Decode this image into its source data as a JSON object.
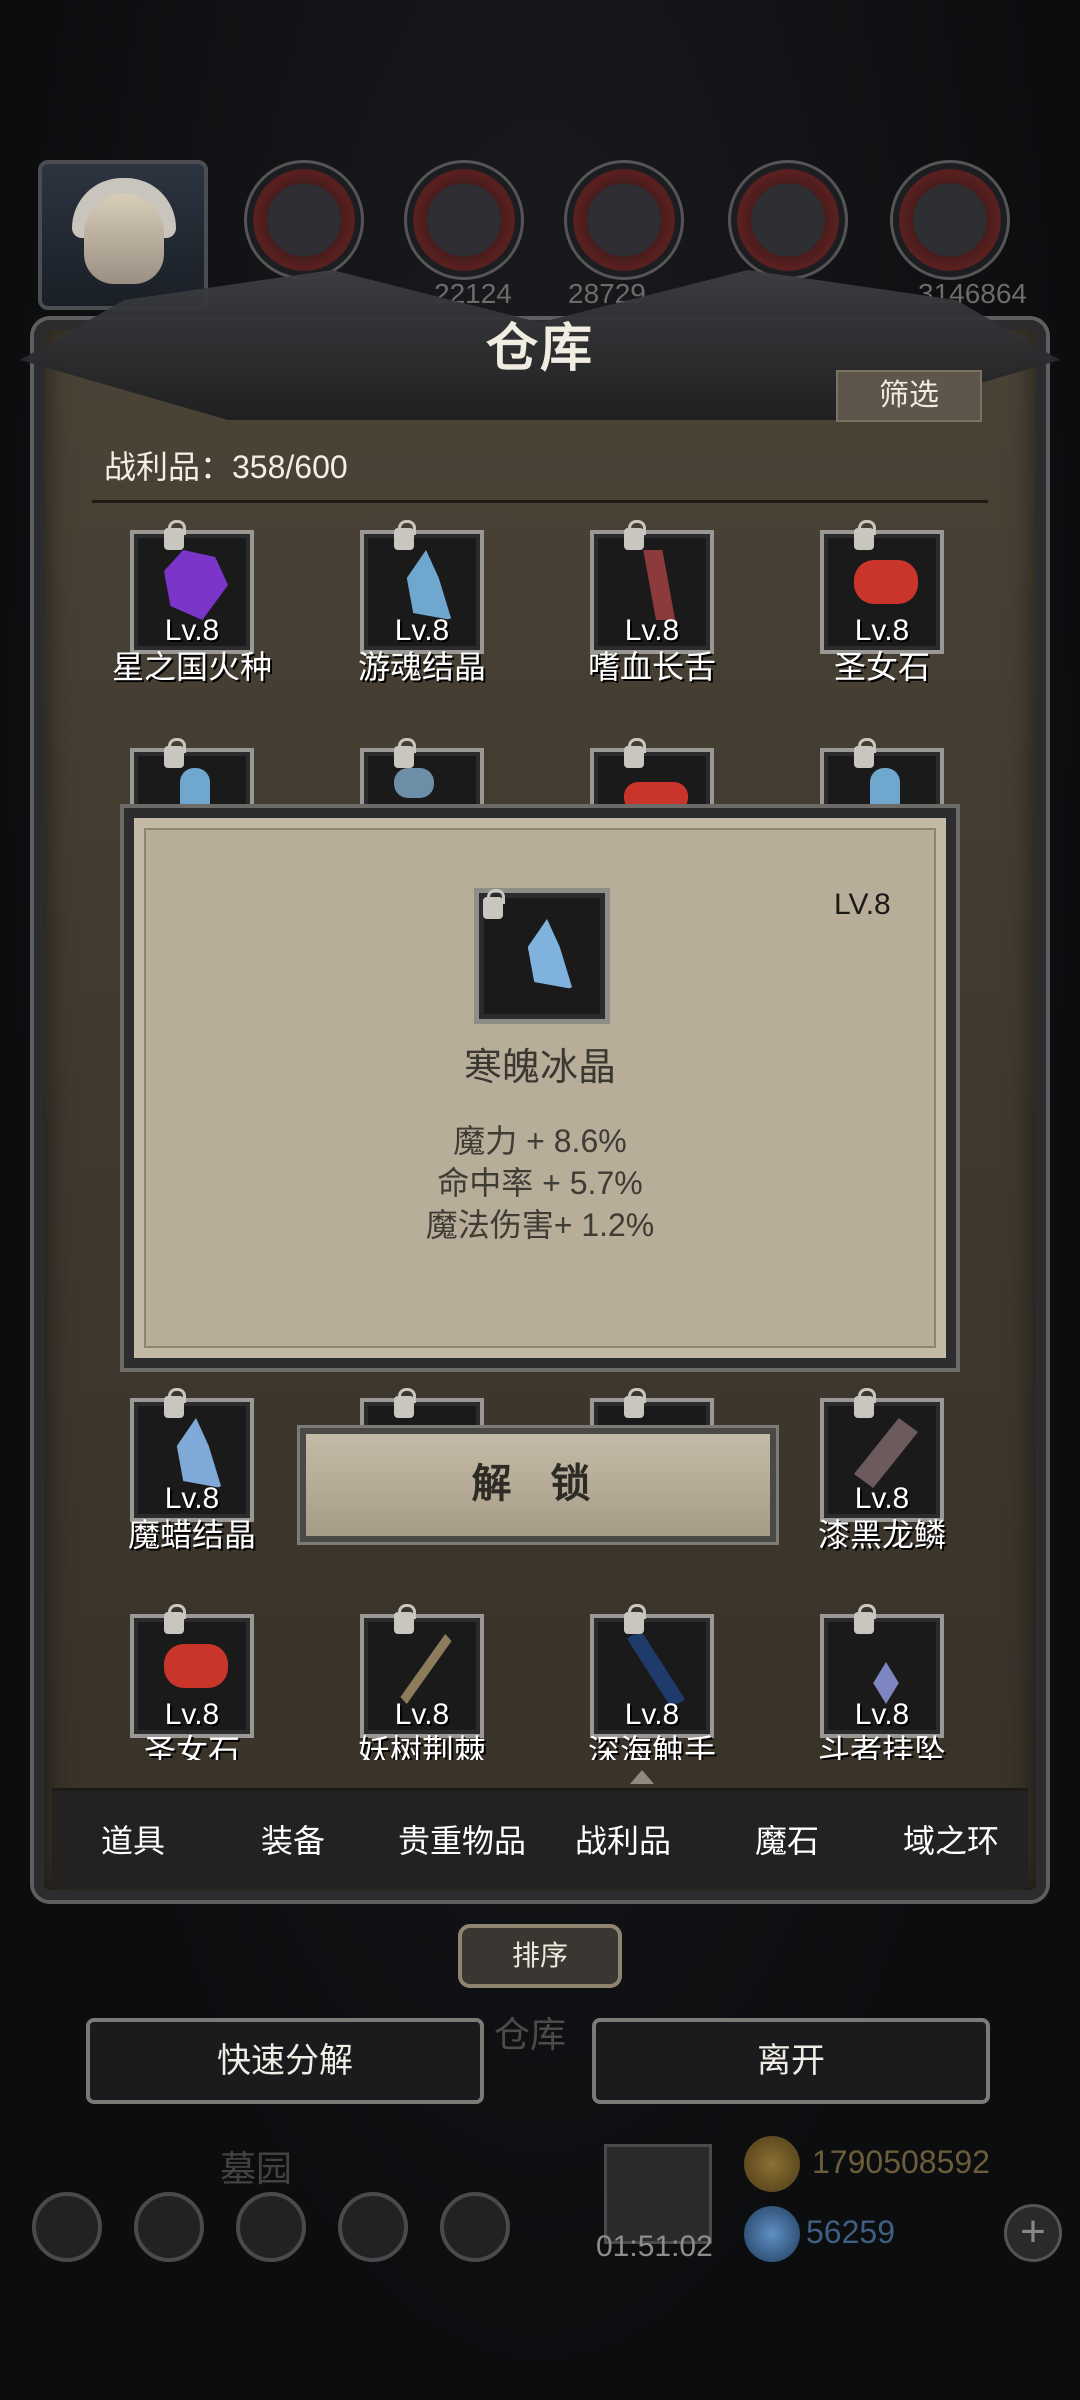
{
  "top": {
    "resources": [
      "",
      "",
      "22124",
      "28729",
      "",
      "3146864"
    ]
  },
  "warehouse": {
    "title": "仓库",
    "filter_label": "筛选",
    "loot_count": "战利品：358/600",
    "items_row1": [
      {
        "name": "星之国火种",
        "level": "Lv.8",
        "gem_color": "#7b35c9"
      },
      {
        "name": "游魂结晶",
        "level": "Lv.8",
        "gem_color": "#6fa7cf"
      },
      {
        "name": "嗜血长舌",
        "level": "Lv.8",
        "gem_color": "#8c3a3c"
      },
      {
        "name": "圣女石",
        "level": "Lv.8",
        "gem_color": "#c9342b"
      }
    ],
    "items_row4": [
      {
        "name": "魔蜡结晶",
        "level": "Lv.8",
        "gem_color": "#7fa9d6"
      },
      {
        "name": "",
        "level": "",
        "gem_color": "#222"
      },
      {
        "name": "",
        "level": "",
        "gem_color": "#222"
      },
      {
        "name": "漆黑龙鳞",
        "level": "Lv.8",
        "gem_color": "#6c5a5c"
      }
    ],
    "items_row5": [
      {
        "name": "圣女石",
        "level": "Lv.8",
        "gem_color": "#c9342b"
      },
      {
        "name": "妖树荆棘",
        "level": "Lv.8",
        "gem_color": "#8c7c5c"
      },
      {
        "name": "深海触手",
        "level": "Lv.8",
        "gem_color": "#1f3b6c"
      },
      {
        "name": "斗者挂坠",
        "level": "Lv.8",
        "gem_color": "#7e86c2"
      }
    ]
  },
  "popup": {
    "level": "LV.8",
    "item_name": "寒魄冰晶",
    "stats": [
      "魔力 + 8.6%",
      "命中率 + 5.7%",
      "魔法伤害+ 1.2%"
    ],
    "unlock_label": "解 锁"
  },
  "tabs": [
    "道具",
    "装备",
    "贵重物品",
    "战利品",
    "魔石",
    "域之环"
  ],
  "active_tab": "战利品",
  "sort_label": "排序",
  "footer": {
    "underlay_label": "仓库",
    "quick_decompose": "快速分解",
    "leave": "离开",
    "graveyard": "墓园",
    "timer": "01:51:02",
    "gold": "1790508592",
    "gems": "56259"
  }
}
